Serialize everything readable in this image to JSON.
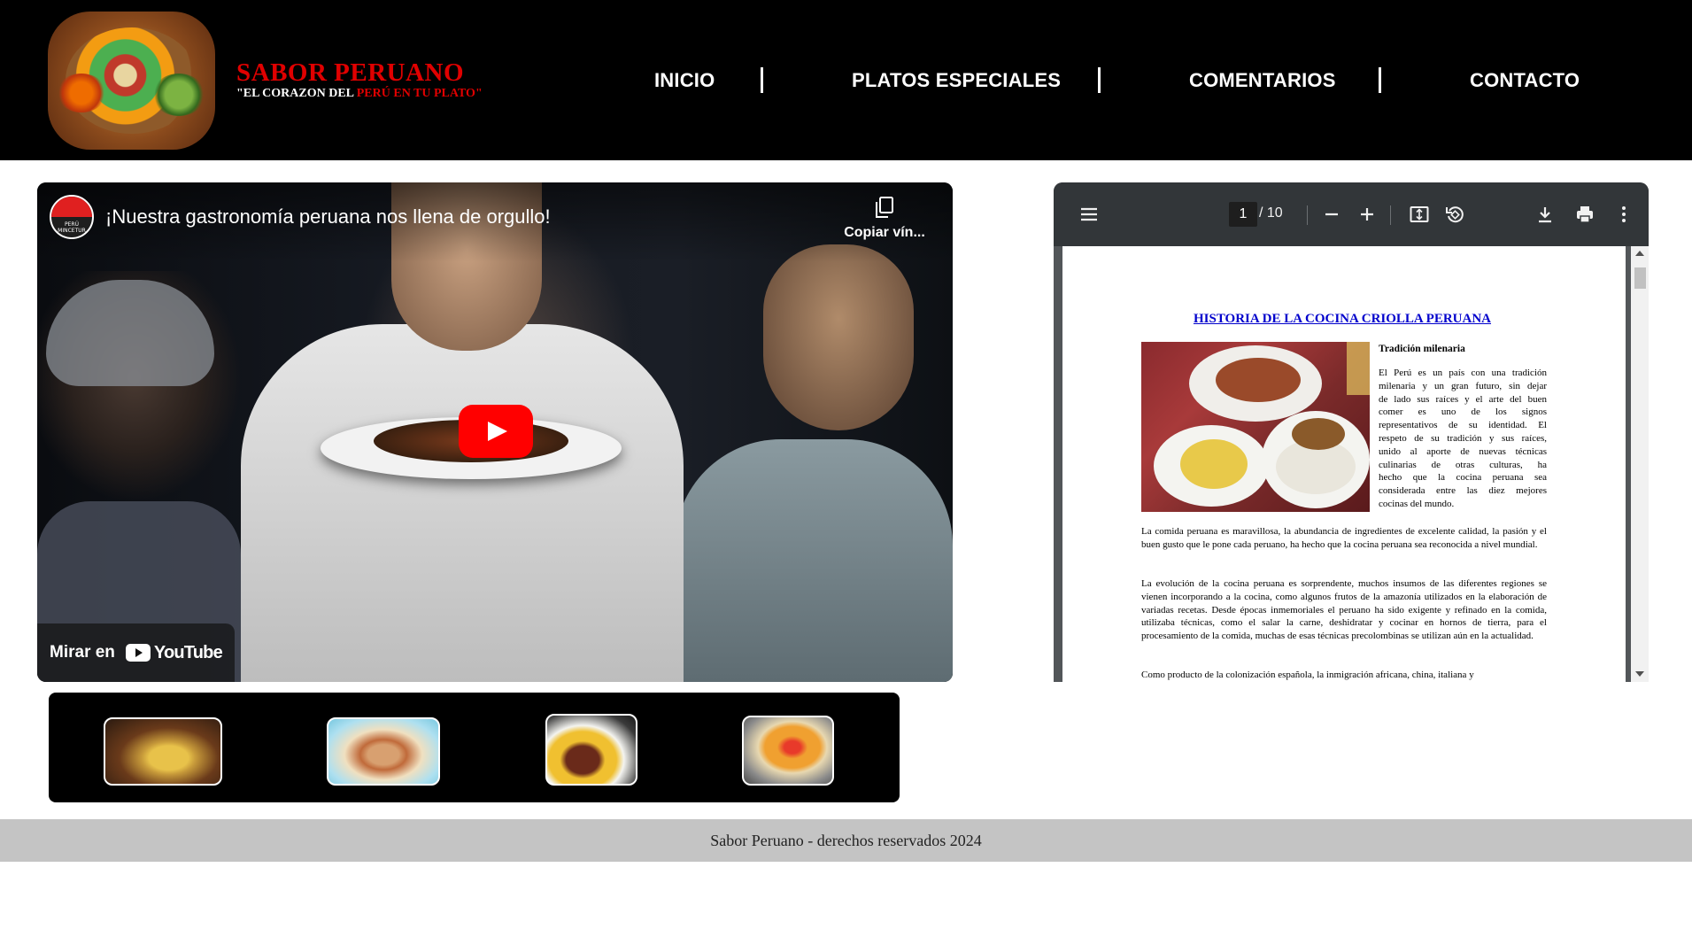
{
  "brand": {
    "title": "SABOR PERUANO",
    "subtitle_prefix": "\"EL CORAZON DEL ",
    "subtitle_highlight": "PERÚ EN TU PLATO\"",
    "accent_color": "#e00000"
  },
  "nav": {
    "items": [
      {
        "label": "INICIO"
      },
      {
        "label": "PLATOS ESPECIALES"
      },
      {
        "label": "COMENTARIOS"
      },
      {
        "label": "CONTACTO"
      }
    ]
  },
  "video": {
    "title": "¡Nuestra gastronomía peruana nos llena de orgullo!",
    "copy_link_label": "Copiar vín...",
    "watch_on_label": "Mirar en",
    "youtube_word": "YouTube",
    "channel_avatar_text": "PERÚ MINCETUR",
    "play_icon": "play-icon",
    "copy_icon": "copy-icon"
  },
  "gallery": {
    "items": [
      {
        "name": "aji-de-gallina-thumb"
      },
      {
        "name": "ceviche-thumb"
      },
      {
        "name": "lomo-saltado-thumb"
      },
      {
        "name": "postre-thumb"
      }
    ]
  },
  "pdf": {
    "current_page": "1",
    "total_pages": "/ 10",
    "toolbar_icons": [
      "menu-icon",
      "zoom-out-icon",
      "zoom-in-icon",
      "fit-page-icon",
      "rotate-icon",
      "download-icon",
      "print-icon",
      "more-options-icon"
    ],
    "doc_title": "HISTORIA DE LA COCINA CRIOLLA PERUANA",
    "subhead": "Tradición milenaria",
    "para1_lines": [
      "El Perú es un país con una tradición",
      "milenaria y un gran futuro, sin dejar",
      "de lado sus raíces y el arte del buen",
      "comer es uno de los signos",
      "representativos de su identidad. El",
      "respeto de su tradición y sus raíces,",
      "unido al aporte de nuevas técnicas",
      "culinarias de otras culturas, ha",
      "hecho que la cocina peruana sea",
      "considerada entre las diez mejores",
      "cocinas del mundo."
    ],
    "para2": "La comida peruana es maravillosa, la abundancia de ingredientes de excelente calidad, la pasión y el buen gusto que le pone cada peruano, ha hecho que la cocina peruana sea reconocida a nivel mundial.",
    "para3": "La evolución de la cocina peruana es sorprendente, muchos insumos de las diferentes regiones se vienen incorporando a la cocina, como algunos frutos de la amazonía utilizados en la elaboración de variadas recetas. Desde épocas inmemoriales el peruano ha sido exigente y refinado en la comida, utilizaba técnicas, como el salar la carne, deshidratar y cocinar en hornos de tierra, para el procesamiento de la comida, muchas de esas técnicas precolombinas se utilizan aún en la actualidad.",
    "para4": "Como producto de la colonización española, la inmigración africana, china, italiana y"
  },
  "footer": {
    "text": "Sabor Peruano - derechos reservados 2024"
  }
}
